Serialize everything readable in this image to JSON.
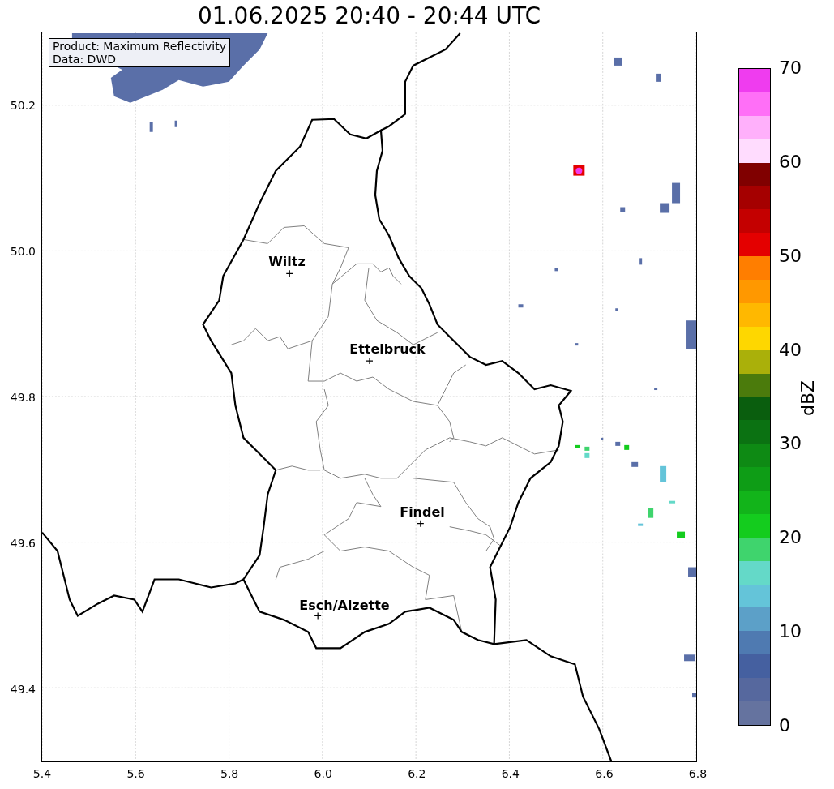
{
  "title": "01.06.2025 20:40 - 20:44 UTC",
  "info_box": {
    "lines": [
      "Product: Maximum Reflectivity",
      "Data: DWD"
    ]
  },
  "map": {
    "x_ticks": [
      "5.4",
      "5.6",
      "5.8",
      "6.0",
      "6.2",
      "6.4",
      "6.6",
      "6.8"
    ],
    "y_ticks": [
      "50.2",
      "50.0",
      "49.8",
      "49.6",
      "49.4"
    ],
    "cities": [
      {
        "name": "Wiltz"
      },
      {
        "name": "Ettelbruck"
      },
      {
        "name": "Findel"
      },
      {
        "name": "Esch/Alzette"
      }
    ]
  },
  "colorbar": {
    "label": "dBZ",
    "ticks": [
      "70",
      "60",
      "50",
      "40",
      "30",
      "20",
      "10",
      "0"
    ],
    "segments": [
      {
        "color": "#ef3cef"
      },
      {
        "color": "#ff6ff7"
      },
      {
        "color": "#ffb0fb"
      },
      {
        "color": "#ffdcfe"
      },
      {
        "color": "#800000"
      },
      {
        "color": "#a50000"
      },
      {
        "color": "#c40000"
      },
      {
        "color": "#e40000"
      },
      {
        "color": "#ff7e00"
      },
      {
        "color": "#ff9800"
      },
      {
        "color": "#ffb800"
      },
      {
        "color": "#fed700"
      },
      {
        "color": "#aab00a"
      },
      {
        "color": "#4b7b0c"
      },
      {
        "color": "#0a5e0e"
      },
      {
        "color": "#0b7212"
      },
      {
        "color": "#0e8a14"
      },
      {
        "color": "#0e9d16"
      },
      {
        "color": "#12b41a"
      },
      {
        "color": "#14cc1e"
      },
      {
        "color": "#3fd46d"
      },
      {
        "color": "#64d9c8"
      },
      {
        "color": "#64c4d9"
      },
      {
        "color": "#5ca0c8"
      },
      {
        "color": "#4f7ab1"
      },
      {
        "color": "#4560a0"
      },
      {
        "color": "#56689e"
      },
      {
        "color": "#65739f"
      }
    ]
  }
}
